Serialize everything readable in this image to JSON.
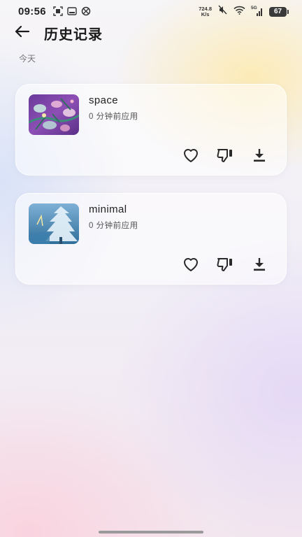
{
  "status_bar": {
    "time": "09:56",
    "net_speed_value": "724.8",
    "net_speed_unit": "K/s",
    "network_type": "5G",
    "battery_level": "67",
    "icons": [
      "screenshot-icon",
      "gallery-icon",
      "blocked-icon",
      "mute-icon",
      "wifi-icon",
      "signal-icon",
      "battery-icon"
    ]
  },
  "header": {
    "back_icon": "arrow-left-icon",
    "title": "历史记录"
  },
  "section": {
    "label": "今天"
  },
  "history": [
    {
      "name": "space",
      "applied": "0 分钟前应用",
      "thumbnail": "floral-purple"
    },
    {
      "name": "minimal",
      "applied": "0 分钟前应用",
      "thumbnail": "blue-tree"
    }
  ],
  "actions": {
    "like_icon": "heart-outline-icon",
    "dislike_icon": "thumbs-down-outline-icon",
    "download_icon": "download-icon"
  },
  "colors": {
    "text_primary": "#1f1f1f",
    "text_secondary": "#555555",
    "icon": "#2a2a2a"
  }
}
